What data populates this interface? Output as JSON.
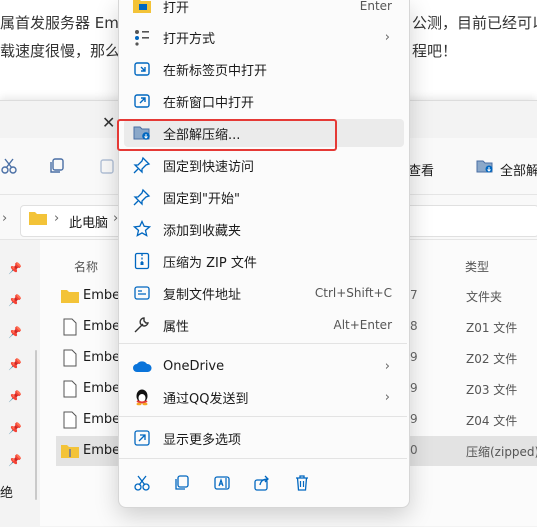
{
  "article": {
    "line1_left": "属首发服务器 Em",
    "line1_right": "公测，目前已经可以",
    "line2_left": "载速度很慢，那么",
    "line2_right": "程吧！"
  },
  "toolbar": {
    "view_label": "查看",
    "extract_all_label": "全部解"
  },
  "address": {
    "this_pc": "此电脑"
  },
  "columns": {
    "name": "名称",
    "type": "类型"
  },
  "files": [
    {
      "name": "Ember",
      "num": "7",
      "type": "文件夹",
      "icon": "folder-icon"
    },
    {
      "name": "Ember",
      "num": "8",
      "type": "Z01 文件",
      "icon": "file-icon"
    },
    {
      "name": "Ember",
      "num": "9",
      "type": "Z02 文件",
      "icon": "file-icon"
    },
    {
      "name": "Ember",
      "num": "9",
      "type": "Z03 文件",
      "icon": "file-icon"
    },
    {
      "name": "Ember",
      "num": "9",
      "type": "Z04 文件",
      "icon": "file-icon"
    },
    {
      "name": "Ember",
      "num": "0",
      "type": "压缩(zipped)",
      "icon": "zip-folder-icon"
    }
  ],
  "nav_label_left": "绝",
  "menu": {
    "items": [
      {
        "label": "打开",
        "shortcut": "Enter",
        "icon": "open-icon"
      },
      {
        "label": "打开方式",
        "submenu": "›",
        "icon": "open-with-icon"
      },
      {
        "label": "在新标签页中打开",
        "icon": "new-tab-icon"
      },
      {
        "label": "在新窗口中打开",
        "icon": "new-window-icon"
      },
      {
        "label": "全部解压缩...",
        "icon": "extract-all-icon"
      },
      {
        "label": "固定到快速访问",
        "icon": "pin-icon"
      },
      {
        "label": "固定到\"开始\"",
        "icon": "pin-start-icon"
      },
      {
        "label": "添加到收藏夹",
        "icon": "star-icon"
      },
      {
        "label": "压缩为 ZIP 文件",
        "icon": "zip-icon"
      },
      {
        "label": "复制文件地址",
        "shortcut": "Ctrl+Shift+C",
        "icon": "copy-path-icon"
      },
      {
        "label": "属性",
        "shortcut": "Alt+Enter",
        "icon": "wrench-icon"
      },
      {
        "label": "OneDrive",
        "submenu": "›",
        "icon": "onedrive-icon"
      },
      {
        "label": "通过QQ发送到",
        "submenu": "›",
        "icon": "qq-icon"
      },
      {
        "label": "显示更多选项",
        "icon": "more-options-icon"
      }
    ],
    "bottom_icons": [
      "cut-icon",
      "copy-icon",
      "rename-icon",
      "share-icon",
      "delete-icon"
    ]
  },
  "colors": {
    "highlight_box": "#e53935",
    "accent": "#0067c0",
    "folder": "#f3c338"
  }
}
